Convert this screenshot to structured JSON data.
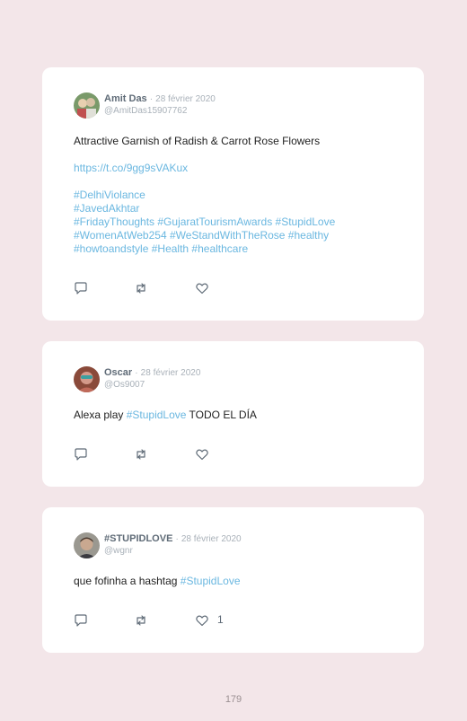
{
  "tweets": [
    {
      "name": "Amit Das",
      "separator": "·",
      "date": "28 février 2020",
      "handle": "@AmitDas15907762",
      "text": "Attractive Garnish of Radish & Carrot Rose Flowers",
      "link": "https://t.co/9gg9sVAKux",
      "hashtag_lines": [
        "#DelhiViolance",
        "#JavedAkhtar",
        "#FridayThoughts #GujaratTourismAwards #StupidLove",
        "#WomenAtWeb254 #WeStandWithTheRose #healthy",
        "#howtoandstyle #Health #healthcare"
      ]
    },
    {
      "name": "Oscar",
      "separator": "·",
      "date": "28 février 2020",
      "handle": "@Os9007",
      "text_before": "Alexa play ",
      "hashtag": "#StupidLove",
      "text_after": " TODO EL DÍA"
    },
    {
      "name": "#STUPIDLOVE",
      "separator": "·",
      "date": "28 février 2020",
      "handle": "@wgnr",
      "text_before": "que fofinha a hashtag ",
      "hashtag": "#StupidLove",
      "like_count": "1"
    }
  ],
  "icons": {
    "reply": "reply-icon",
    "retweet": "retweet-icon",
    "like": "heart-icon"
  },
  "colors": {
    "background": "#f3e6e9",
    "card": "#ffffff",
    "link": "#6ab7e0",
    "name": "#5f6b77",
    "meta": "#a9b1b9"
  },
  "page_number": "179"
}
